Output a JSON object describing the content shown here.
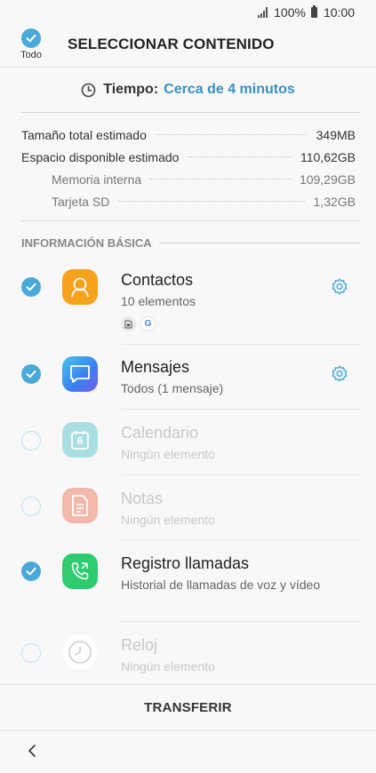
{
  "status_bar": {
    "battery": "100%",
    "time": "10:00"
  },
  "header": {
    "select_all_label": "Todo",
    "title": "SELECCIONAR CONTENIDO"
  },
  "time_estimate": {
    "label": "Tiempo:",
    "value": "Cerca de 4 minutos"
  },
  "storage": {
    "total": {
      "label": "Tamaño total estimado",
      "value": "349MB"
    },
    "available": {
      "label": "Espacio disponible estimado",
      "value": "110,62GB"
    },
    "internal": {
      "label": "Memoria interna",
      "value": "109,29GB"
    },
    "sd": {
      "label": "Tarjeta SD",
      "value": "1,32GB"
    }
  },
  "section": {
    "title": "INFORMACIÓN BÁSICA"
  },
  "items": [
    {
      "title": "Contactos",
      "subtitle": "10 elementos",
      "checked": true,
      "icon": "contacts-icon",
      "color": "#f6a21d",
      "settings": true
    },
    {
      "title": "Mensajes",
      "subtitle": "Todos (1 mensaje)",
      "checked": true,
      "icon": "messages-icon",
      "color": "#3e8ef0",
      "settings": true
    },
    {
      "title": "Calendario",
      "subtitle": "Ningún elemento",
      "checked": false,
      "icon": "calendar-icon",
      "color": "#a9dfe3",
      "calendar_day": "6"
    },
    {
      "title": "Notas",
      "subtitle": "Ningún elemento",
      "checked": false,
      "icon": "notes-icon",
      "color": "#f3b8ac"
    },
    {
      "title": "Registro llamadas",
      "subtitle": "Historial de llamadas de voz y vídeo",
      "checked": true,
      "icon": "call-log-icon",
      "color": "#2ecc6e"
    },
    {
      "title": "Reloj",
      "subtitle": "Ningún elemento",
      "checked": false,
      "icon": "clock-app-icon",
      "color": "#ffffff"
    }
  ],
  "contacts_badges": {
    "sim": "sim-card-icon",
    "google": "G"
  },
  "bottom": {
    "transfer_label": "TRANSFERIR"
  }
}
